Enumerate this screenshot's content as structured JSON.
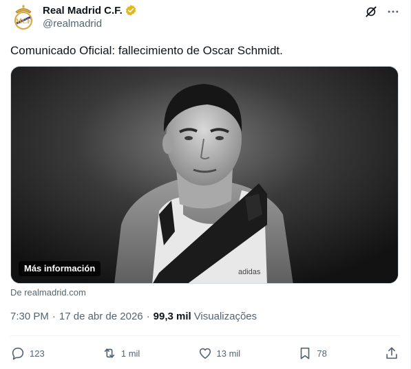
{
  "author": {
    "display_name": "Real Madrid C.F.",
    "handle": "@realmadrid",
    "verified": true,
    "verified_color": "#e2b719",
    "avatar_icon": "real-madrid-crest-icon"
  },
  "top_actions": {
    "grok_icon": "grok-icon",
    "more_icon": "more-dots-icon"
  },
  "tweet": {
    "text": "Comunicado Oficial: fallecimiento de Oscar Schmidt."
  },
  "media": {
    "badge_label": "Más información",
    "jersey_text": "adidas"
  },
  "source": {
    "label": "De realmadrid.com"
  },
  "meta": {
    "time": "7:30 PM",
    "date": "17 de abr de 2026",
    "views_count": "99,3 mil",
    "views_label": "Visualizações"
  },
  "actions": {
    "replies": "123",
    "reposts": "1 mil",
    "likes": "13 mil",
    "bookmarks": "78"
  },
  "colors": {
    "text_primary": "#0f1419",
    "text_secondary": "#536471",
    "border": "#cfd9de"
  }
}
